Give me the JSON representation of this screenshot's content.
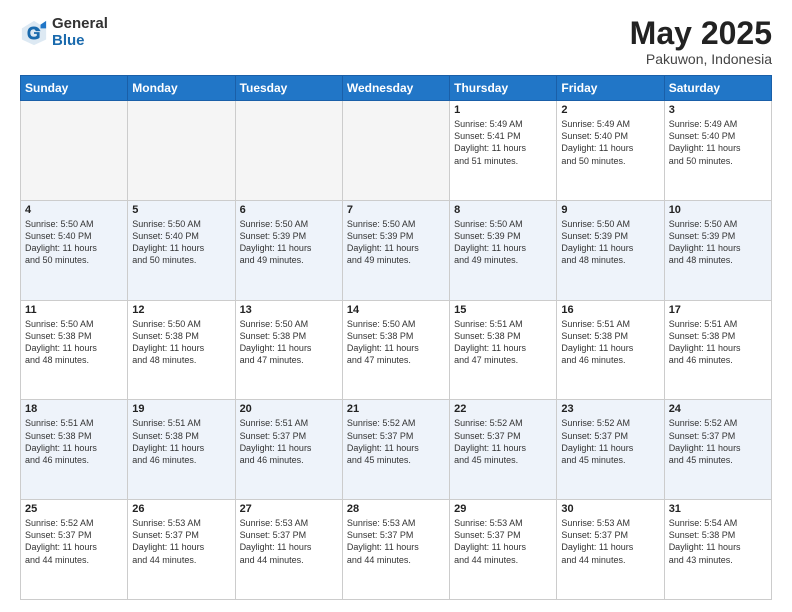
{
  "logo": {
    "general": "General",
    "blue": "Blue"
  },
  "header": {
    "month": "May 2025",
    "location": "Pakuwon, Indonesia"
  },
  "weekdays": [
    "Sunday",
    "Monday",
    "Tuesday",
    "Wednesday",
    "Thursday",
    "Friday",
    "Saturday"
  ],
  "weeks": [
    [
      {
        "day": "",
        "info": ""
      },
      {
        "day": "",
        "info": ""
      },
      {
        "day": "",
        "info": ""
      },
      {
        "day": "",
        "info": ""
      },
      {
        "day": "1",
        "info": "Sunrise: 5:49 AM\nSunset: 5:41 PM\nDaylight: 11 hours\nand 51 minutes."
      },
      {
        "day": "2",
        "info": "Sunrise: 5:49 AM\nSunset: 5:40 PM\nDaylight: 11 hours\nand 50 minutes."
      },
      {
        "day": "3",
        "info": "Sunrise: 5:49 AM\nSunset: 5:40 PM\nDaylight: 11 hours\nand 50 minutes."
      }
    ],
    [
      {
        "day": "4",
        "info": "Sunrise: 5:50 AM\nSunset: 5:40 PM\nDaylight: 11 hours\nand 50 minutes."
      },
      {
        "day": "5",
        "info": "Sunrise: 5:50 AM\nSunset: 5:40 PM\nDaylight: 11 hours\nand 50 minutes."
      },
      {
        "day": "6",
        "info": "Sunrise: 5:50 AM\nSunset: 5:39 PM\nDaylight: 11 hours\nand 49 minutes."
      },
      {
        "day": "7",
        "info": "Sunrise: 5:50 AM\nSunset: 5:39 PM\nDaylight: 11 hours\nand 49 minutes."
      },
      {
        "day": "8",
        "info": "Sunrise: 5:50 AM\nSunset: 5:39 PM\nDaylight: 11 hours\nand 49 minutes."
      },
      {
        "day": "9",
        "info": "Sunrise: 5:50 AM\nSunset: 5:39 PM\nDaylight: 11 hours\nand 48 minutes."
      },
      {
        "day": "10",
        "info": "Sunrise: 5:50 AM\nSunset: 5:39 PM\nDaylight: 11 hours\nand 48 minutes."
      }
    ],
    [
      {
        "day": "11",
        "info": "Sunrise: 5:50 AM\nSunset: 5:38 PM\nDaylight: 11 hours\nand 48 minutes."
      },
      {
        "day": "12",
        "info": "Sunrise: 5:50 AM\nSunset: 5:38 PM\nDaylight: 11 hours\nand 48 minutes."
      },
      {
        "day": "13",
        "info": "Sunrise: 5:50 AM\nSunset: 5:38 PM\nDaylight: 11 hours\nand 47 minutes."
      },
      {
        "day": "14",
        "info": "Sunrise: 5:50 AM\nSunset: 5:38 PM\nDaylight: 11 hours\nand 47 minutes."
      },
      {
        "day": "15",
        "info": "Sunrise: 5:51 AM\nSunset: 5:38 PM\nDaylight: 11 hours\nand 47 minutes."
      },
      {
        "day": "16",
        "info": "Sunrise: 5:51 AM\nSunset: 5:38 PM\nDaylight: 11 hours\nand 46 minutes."
      },
      {
        "day": "17",
        "info": "Sunrise: 5:51 AM\nSunset: 5:38 PM\nDaylight: 11 hours\nand 46 minutes."
      }
    ],
    [
      {
        "day": "18",
        "info": "Sunrise: 5:51 AM\nSunset: 5:38 PM\nDaylight: 11 hours\nand 46 minutes."
      },
      {
        "day": "19",
        "info": "Sunrise: 5:51 AM\nSunset: 5:38 PM\nDaylight: 11 hours\nand 46 minutes."
      },
      {
        "day": "20",
        "info": "Sunrise: 5:51 AM\nSunset: 5:37 PM\nDaylight: 11 hours\nand 46 minutes."
      },
      {
        "day": "21",
        "info": "Sunrise: 5:52 AM\nSunset: 5:37 PM\nDaylight: 11 hours\nand 45 minutes."
      },
      {
        "day": "22",
        "info": "Sunrise: 5:52 AM\nSunset: 5:37 PM\nDaylight: 11 hours\nand 45 minutes."
      },
      {
        "day": "23",
        "info": "Sunrise: 5:52 AM\nSunset: 5:37 PM\nDaylight: 11 hours\nand 45 minutes."
      },
      {
        "day": "24",
        "info": "Sunrise: 5:52 AM\nSunset: 5:37 PM\nDaylight: 11 hours\nand 45 minutes."
      }
    ],
    [
      {
        "day": "25",
        "info": "Sunrise: 5:52 AM\nSunset: 5:37 PM\nDaylight: 11 hours\nand 44 minutes."
      },
      {
        "day": "26",
        "info": "Sunrise: 5:53 AM\nSunset: 5:37 PM\nDaylight: 11 hours\nand 44 minutes."
      },
      {
        "day": "27",
        "info": "Sunrise: 5:53 AM\nSunset: 5:37 PM\nDaylight: 11 hours\nand 44 minutes."
      },
      {
        "day": "28",
        "info": "Sunrise: 5:53 AM\nSunset: 5:37 PM\nDaylight: 11 hours\nand 44 minutes."
      },
      {
        "day": "29",
        "info": "Sunrise: 5:53 AM\nSunset: 5:37 PM\nDaylight: 11 hours\nand 44 minutes."
      },
      {
        "day": "30",
        "info": "Sunrise: 5:53 AM\nSunset: 5:37 PM\nDaylight: 11 hours\nand 44 minutes."
      },
      {
        "day": "31",
        "info": "Sunrise: 5:54 AM\nSunset: 5:38 PM\nDaylight: 11 hours\nand 43 minutes."
      }
    ]
  ]
}
